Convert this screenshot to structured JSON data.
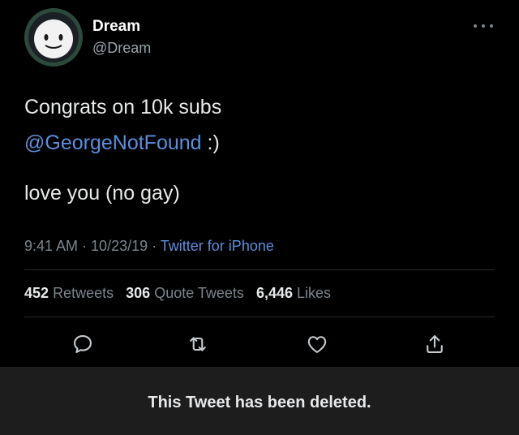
{
  "tweet": {
    "author_name": "Dream",
    "author_handle": "@Dream",
    "text_line1": "Congrats on 10k subs",
    "mention": "@GeorgeNotFound",
    "mention_suffix": " :)",
    "text_line3": "love you (no gay)",
    "time": "9:41 AM",
    "separator": " · ",
    "date": "10/23/19",
    "source": "Twitter for iPhone"
  },
  "stats": {
    "retweets_count": "452",
    "retweets_label": "Retweets",
    "quotes_count": "306",
    "quotes_label": "Quote Tweets",
    "likes_count": "6,446",
    "likes_label": "Likes"
  },
  "actions": {
    "reply_icon": "reply-bubble-icon",
    "retweet_icon": "retweet-arrows-icon",
    "like_icon": "heart-icon",
    "share_icon": "share-upload-icon"
  },
  "banner": {
    "message": "This Tweet has been deleted."
  },
  "colors": {
    "background": "#000000",
    "link": "#5b8fde",
    "muted": "#7c858c",
    "banner_bg": "#1d1d1e"
  }
}
